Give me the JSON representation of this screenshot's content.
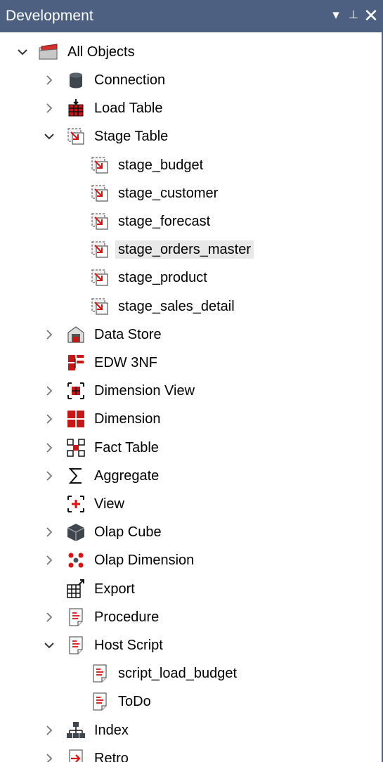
{
  "panel": {
    "title": "Development",
    "dropdown_glyph": "▾",
    "pin_glyph": "⊥",
    "close_glyph": "✕"
  },
  "colors": {
    "titlebar": "#4d6082",
    "accent_red": "#cc1111",
    "selection": "#e8e8e8"
  },
  "tree": {
    "root": {
      "label": "All Objects",
      "icon": "folder-icon",
      "expanded": true
    },
    "items": [
      {
        "label": "Connection",
        "icon": "connection-icon",
        "level": 1,
        "expander": "collapsed"
      },
      {
        "label": "Load Table",
        "icon": "load-table-icon",
        "level": 1,
        "expander": "collapsed"
      },
      {
        "label": "Stage Table",
        "icon": "stage-table-icon",
        "level": 1,
        "expander": "expanded"
      },
      {
        "label": "stage_budget",
        "icon": "stage-table-icon",
        "level": 2,
        "expander": "none"
      },
      {
        "label": "stage_customer",
        "icon": "stage-table-icon",
        "level": 2,
        "expander": "none"
      },
      {
        "label": "stage_forecast",
        "icon": "stage-table-icon",
        "level": 2,
        "expander": "none"
      },
      {
        "label": "stage_orders_master",
        "icon": "stage-table-icon",
        "level": 2,
        "expander": "none",
        "selected": true
      },
      {
        "label": "stage_product",
        "icon": "stage-table-icon",
        "level": 2,
        "expander": "none"
      },
      {
        "label": "stage_sales_detail",
        "icon": "stage-table-icon",
        "level": 2,
        "expander": "none"
      },
      {
        "label": "Data Store",
        "icon": "data-store-icon",
        "level": 1,
        "expander": "collapsed"
      },
      {
        "label": "EDW 3NF",
        "icon": "edw-icon",
        "level": 1,
        "expander": "none"
      },
      {
        "label": "Dimension View",
        "icon": "dimension-view-icon",
        "level": 1,
        "expander": "collapsed"
      },
      {
        "label": "Dimension",
        "icon": "dimension-icon",
        "level": 1,
        "expander": "collapsed"
      },
      {
        "label": "Fact Table",
        "icon": "fact-table-icon",
        "level": 1,
        "expander": "collapsed"
      },
      {
        "label": "Aggregate",
        "icon": "sigma-icon",
        "level": 1,
        "expander": "collapsed"
      },
      {
        "label": "View",
        "icon": "view-icon",
        "level": 1,
        "expander": "none"
      },
      {
        "label": "Olap Cube",
        "icon": "cube-icon",
        "level": 1,
        "expander": "collapsed"
      },
      {
        "label": "Olap Dimension",
        "icon": "olap-dimension-icon",
        "level": 1,
        "expander": "collapsed"
      },
      {
        "label": "Export",
        "icon": "export-icon",
        "level": 1,
        "expander": "none"
      },
      {
        "label": "Procedure",
        "icon": "document-icon",
        "level": 1,
        "expander": "collapsed"
      },
      {
        "label": "Host Script",
        "icon": "document-icon",
        "level": 1,
        "expander": "expanded"
      },
      {
        "label": "script_load_budget",
        "icon": "document-icon",
        "level": 2,
        "expander": "none"
      },
      {
        "label": "ToDo",
        "icon": "document-icon",
        "level": 2,
        "expander": "none"
      },
      {
        "label": "Index",
        "icon": "index-icon",
        "level": 1,
        "expander": "collapsed"
      },
      {
        "label": "Retro",
        "icon": "retro-icon",
        "level": 1,
        "expander": "collapsed"
      }
    ]
  }
}
